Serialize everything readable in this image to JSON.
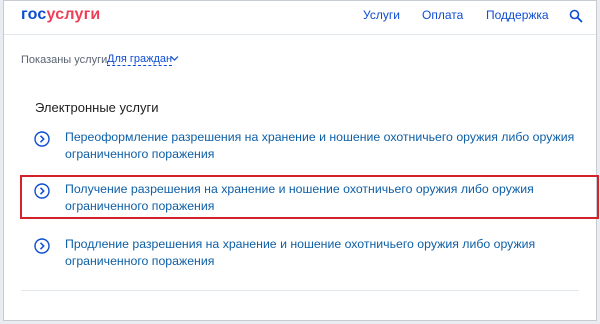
{
  "header": {
    "logo_gos": "гос",
    "logo_uslugi": "услуги",
    "nav": {
      "services": "Услуги",
      "payment": "Оплата",
      "support": "Поддержка"
    },
    "search_icon": "search-icon"
  },
  "filter": {
    "label": "Показаны услуги",
    "selected": "Для граждан"
  },
  "section": {
    "title": "Электронные услуги",
    "items": [
      {
        "label": "Переоформление разрешения на хранение и ношение охотничьего оружия либо оружия ограниченного поражения"
      },
      {
        "label": "Получение разрешения на хранение и ношение охотничьего оружия либо оружия ограниченного поражения",
        "highlighted": true
      },
      {
        "label": "Продление разрешения на хранение и ношение охотничьего оружия либо оружия ограниченного поражения"
      }
    ]
  },
  "colors": {
    "brand_blue": "#0d4cd3",
    "brand_red": "#ee3f58",
    "link_blue": "#0d5fa6",
    "highlight_red": "#d2232a"
  }
}
